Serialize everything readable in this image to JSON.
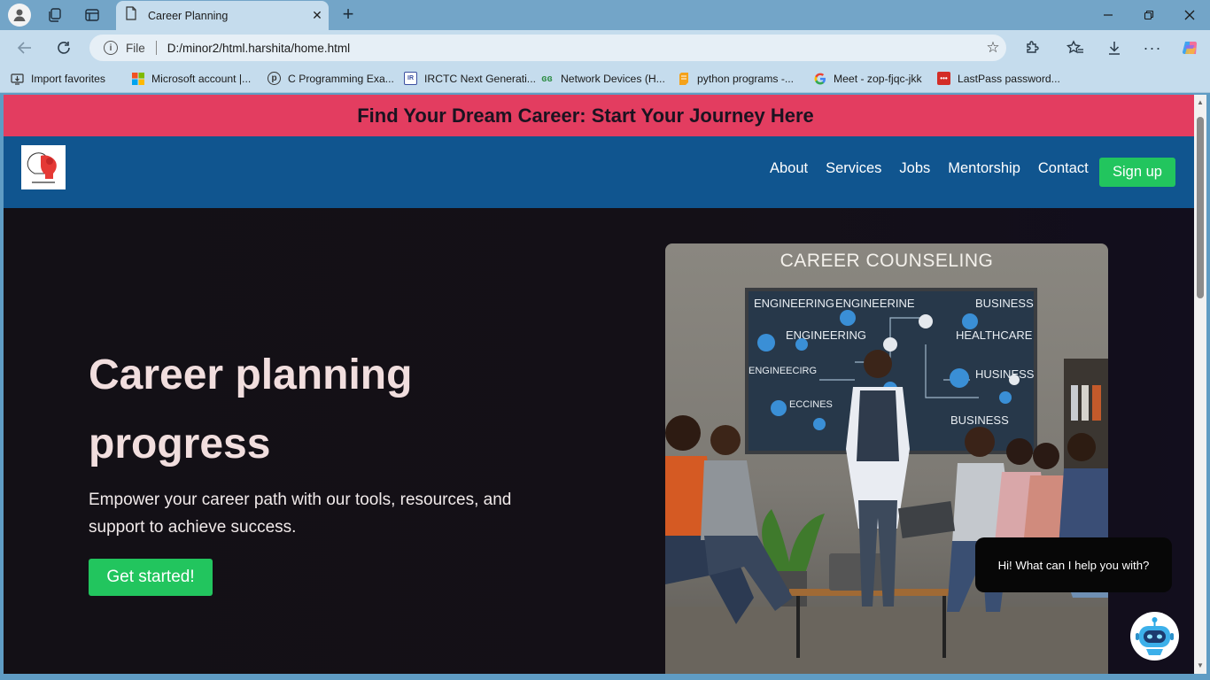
{
  "browser": {
    "tab_title": "Career Planning",
    "new_tab_symbol": "+",
    "close_symbol": "✕",
    "address": {
      "scheme_label": "File",
      "url": "D:/minor2/html.harshita/home.html"
    },
    "favorites": [
      {
        "label": "Import favorites",
        "icon": "import-icon"
      },
      {
        "label": "Microsoft account |...",
        "icon": "microsoft-logo-icon"
      },
      {
        "label": "C Programming Exa...",
        "icon": "programiz-icon"
      },
      {
        "label": "IRCTC Next Generati...",
        "icon": "irctc-icon"
      },
      {
        "label": "Network Devices (H...",
        "icon": "gfg-icon"
      },
      {
        "label": "python programs -...",
        "icon": "document-icon"
      },
      {
        "label": "Meet - zop-fjqc-jkk",
        "icon": "google-icon"
      },
      {
        "label": "LastPass password...",
        "icon": "lastpass-icon"
      }
    ]
  },
  "page": {
    "banner": "Find Your Dream Career: Start Your Journey Here",
    "nav": {
      "links": [
        "About",
        "Services",
        "Jobs",
        "Mentorship",
        "Contact"
      ],
      "signup": "Sign up"
    },
    "hero": {
      "title": "Career planning progress",
      "subtitle": "Empower your career path with our tools, resources, and support to achieve success.",
      "cta": "Get started!",
      "image": {
        "heading": "CAREER COUNSELING",
        "board_labels": [
          "ENGINEERING",
          "ENGINEERINE",
          "BUSINESS",
          "ENGINEERING",
          "HEALTHCARE",
          "ENGINEECIRG",
          "HUSINESS",
          "BUSINESS",
          "ECCINES"
        ]
      }
    },
    "chat": {
      "bubble": "Hi! What can I help you with?"
    }
  },
  "colors": {
    "banner": "#e33d60",
    "navbar": "#10558f",
    "cta": "#22c55e",
    "hero_bg": "#131016"
  }
}
